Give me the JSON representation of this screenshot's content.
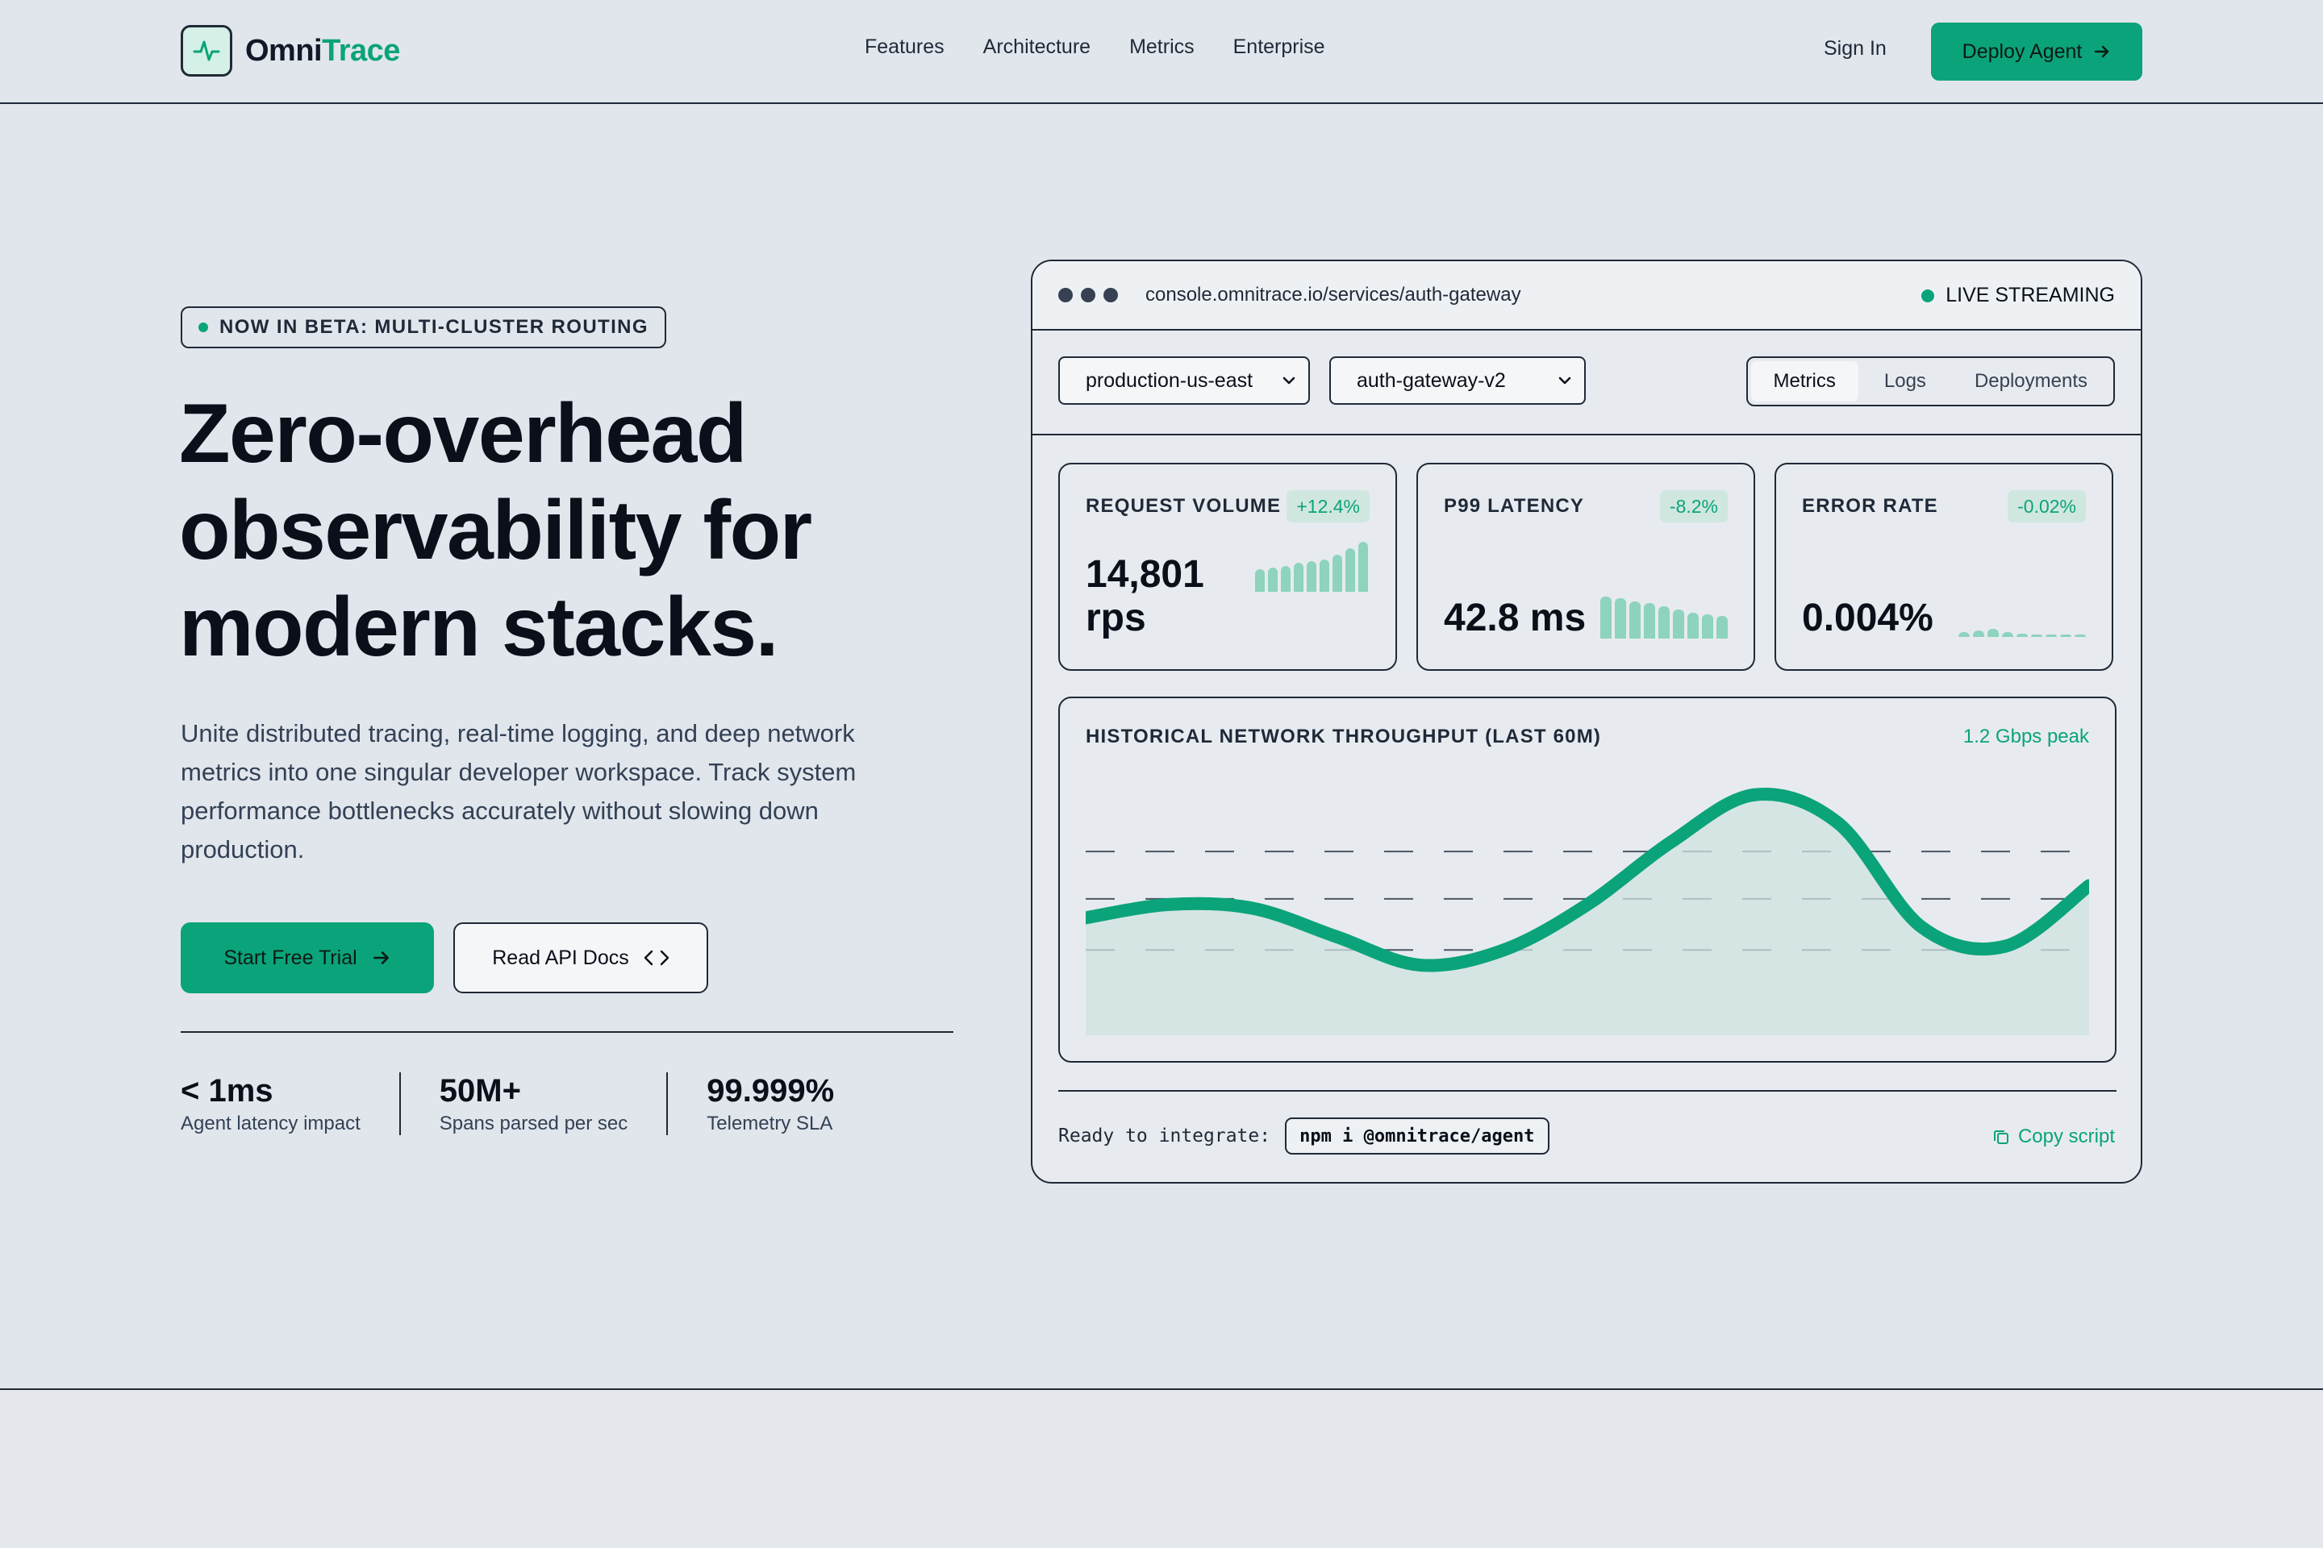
{
  "brand": {
    "name_part1": "Omni",
    "name_part2": "Trace",
    "accent": "#0ba37a"
  },
  "nav": {
    "items": [
      "Features",
      "Architecture",
      "Metrics",
      "Enterprise"
    ],
    "sign_in": "Sign In",
    "deploy": "Deploy Agent"
  },
  "hero": {
    "badge": "NOW IN BETA: MULTI-CLUSTER ROUTING",
    "title_line1": "Zero-overhead",
    "title_line2": "observability for",
    "title_line3": "modern stacks.",
    "subtitle": "Unite distributed tracing, real-time logging, and deep network metrics into one singular developer workspace. Track system performance bottlenecks accurately without slowing down production.",
    "cta_primary": "Start Free Trial",
    "cta_secondary": "Read API Docs",
    "stats": [
      {
        "value": "< 1ms",
        "label": "Agent latency impact"
      },
      {
        "value": "50M+",
        "label": "Spans parsed per sec"
      },
      {
        "value": "99.999%",
        "label": "Telemetry SLA"
      }
    ]
  },
  "console": {
    "url": "console.omnitrace.io/services/auth-gateway",
    "live": "LIVE STREAMING",
    "env_select": "production-us-east",
    "service_select": "auth-gateway-v2",
    "tabs": [
      "Metrics",
      "Logs",
      "Deployments"
    ],
    "active_tab": "Metrics",
    "metrics": [
      {
        "label": "REQUEST VOLUME",
        "delta": "+12.4%",
        "value": "14,801",
        "unit": "rps"
      },
      {
        "label": "P99 LATENCY",
        "delta": "-8.2%",
        "value": "42.8 ms"
      },
      {
        "label": "ERROR RATE",
        "delta": "-0.02%",
        "value": "0.004%"
      }
    ],
    "throughput": {
      "title": "HISTORICAL NETWORK THROUGHPUT (LAST 60M)",
      "peak": "1.2 Gbps peak"
    },
    "integrate_label": "Ready to integrate:",
    "install_cmd": "npm i @omnitrace/agent",
    "copy_label": "Copy script"
  },
  "chart_data": {
    "type": "area",
    "title": "HISTORICAL NETWORK THROUGHPUT (LAST 60M)",
    "xlabel": "",
    "ylabel": "",
    "x": [
      0,
      5,
      10,
      15,
      20,
      25,
      30,
      35,
      40,
      45,
      50,
      55,
      60
    ],
    "series": [
      {
        "values": [
          0.55,
          0.62,
          0.6,
          0.45,
          0.3,
          0.38,
          0.62,
          0.95,
          1.2,
          1.05,
          0.5,
          0.4,
          0.72
        ]
      }
    ]
  }
}
